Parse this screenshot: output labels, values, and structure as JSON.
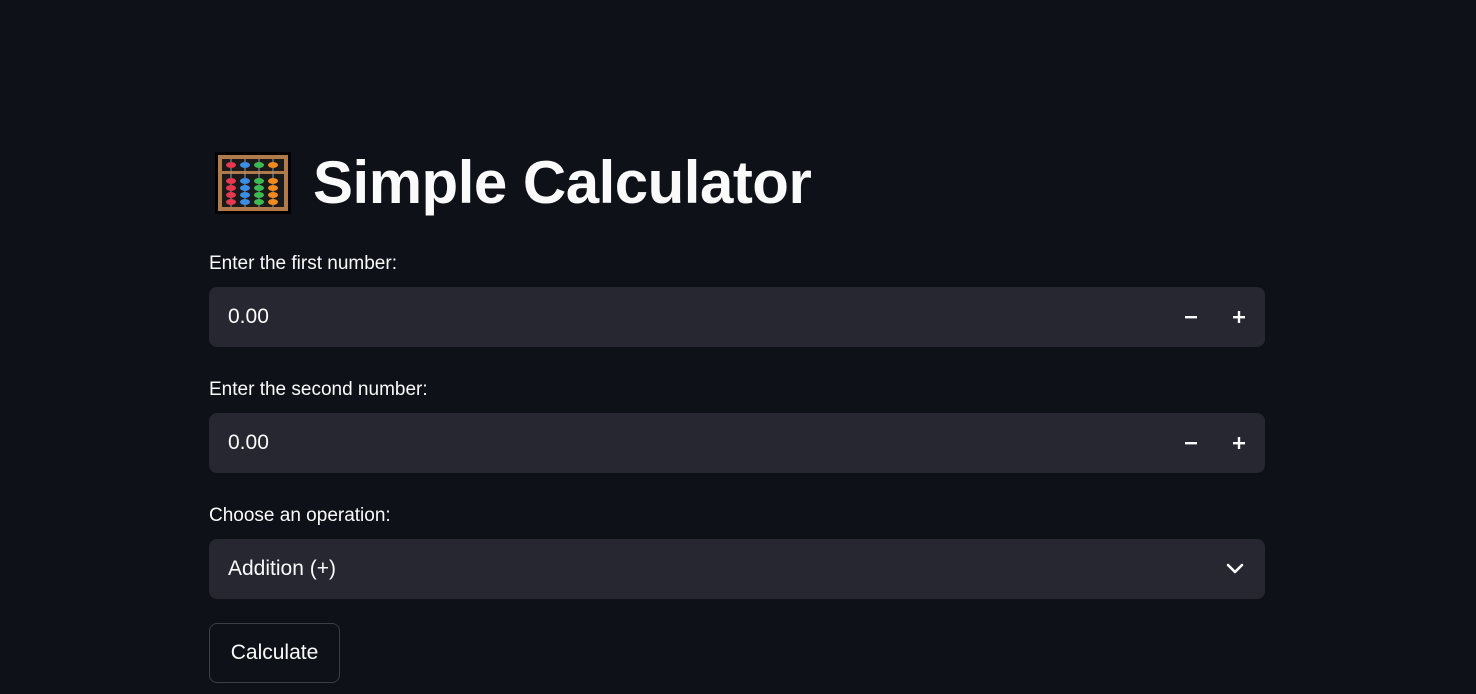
{
  "header": {
    "title": "Simple Calculator",
    "title_icon": "abacus-icon"
  },
  "form": {
    "first_number": {
      "label": "Enter the first number:",
      "value": "0.00",
      "decrement_icon": "minus-icon",
      "increment_icon": "plus-icon"
    },
    "second_number": {
      "label": "Enter the second number:",
      "value": "0.00",
      "decrement_icon": "minus-icon",
      "increment_icon": "plus-icon"
    },
    "operation": {
      "label": "Choose an operation:",
      "selected": "Addition (+)",
      "dropdown_icon": "chevron-down-icon"
    },
    "calculate_label": "Calculate"
  },
  "colors": {
    "background": "#0e1117",
    "input_background": "#262730",
    "text": "#fafafa",
    "button_border": "#3b3d47"
  }
}
